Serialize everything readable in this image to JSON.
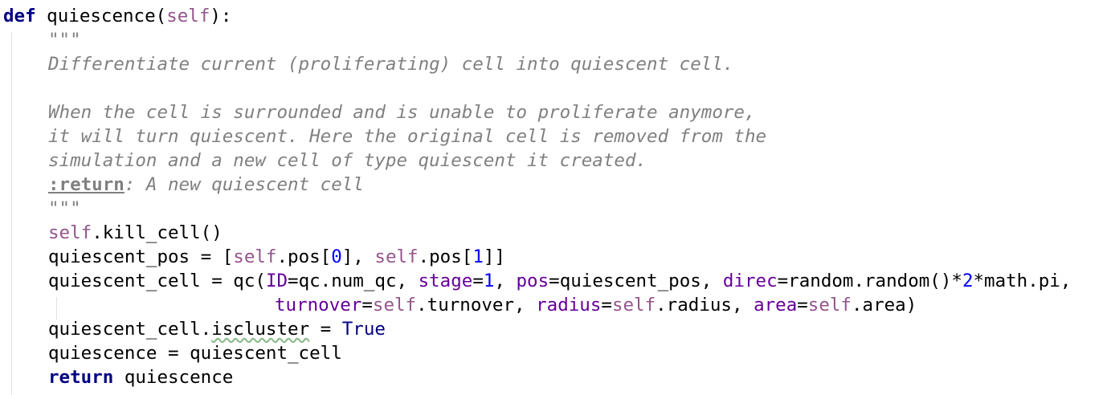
{
  "code": {
    "def_kw": "def",
    "func_name": " quiescence(",
    "self": "self",
    "colon": "):",
    "docstring_open": "\"\"\"",
    "doc_line1": "Differentiate current (proliferating) cell into quiescent cell.",
    "doc_line2": "When the cell is surrounded and is unable to proliferate anymore,",
    "doc_line3": "it will turn quiescent. Here the original cell is removed from the",
    "doc_line4": "simulation and a new cell of type quiescent it created.",
    "doc_return_tag": ":return",
    "doc_return_text": ": A new quiescent cell",
    "docstring_close": "\"\"\"",
    "kill_call": ".kill_cell()",
    "pos_assign": "quiescent_pos = [",
    "pos_attr": ".pos[",
    "zero": "0",
    "pos_sep": "], ",
    "one": "1",
    "pos_close": "]]",
    "cell_assign": "quiescent_cell = qc(",
    "p_id": "ID",
    "v_id": "=qc.num_qc, ",
    "p_stage": "stage",
    "v_stage_eq": "=",
    "v_stage_sep": ", ",
    "p_pos": "pos",
    "v_pos": "=quiescent_pos, ",
    "p_direc": "direc",
    "v_direc": "=random.random()*",
    "two": "2",
    "v_direc_end": "*math.pi,",
    "p_turnover": "turnover",
    "v_turnover_eq": "=",
    "v_turnover_attr": ".turnover, ",
    "p_radius": "radius",
    "v_radius_eq": "=",
    "v_radius_attr": ".radius, ",
    "p_area": "area",
    "v_area_eq": "=",
    "v_area_attr": ".area)",
    "iscluster_obj": "quiescent_cell.",
    "iscluster_attr": "iscluster",
    "iscluster_eq": " = ",
    "true_kw": "True",
    "quiescence_assign": "quiescence = quiescent_cell",
    "return_kw": "return",
    "return_val": " quiescence"
  }
}
